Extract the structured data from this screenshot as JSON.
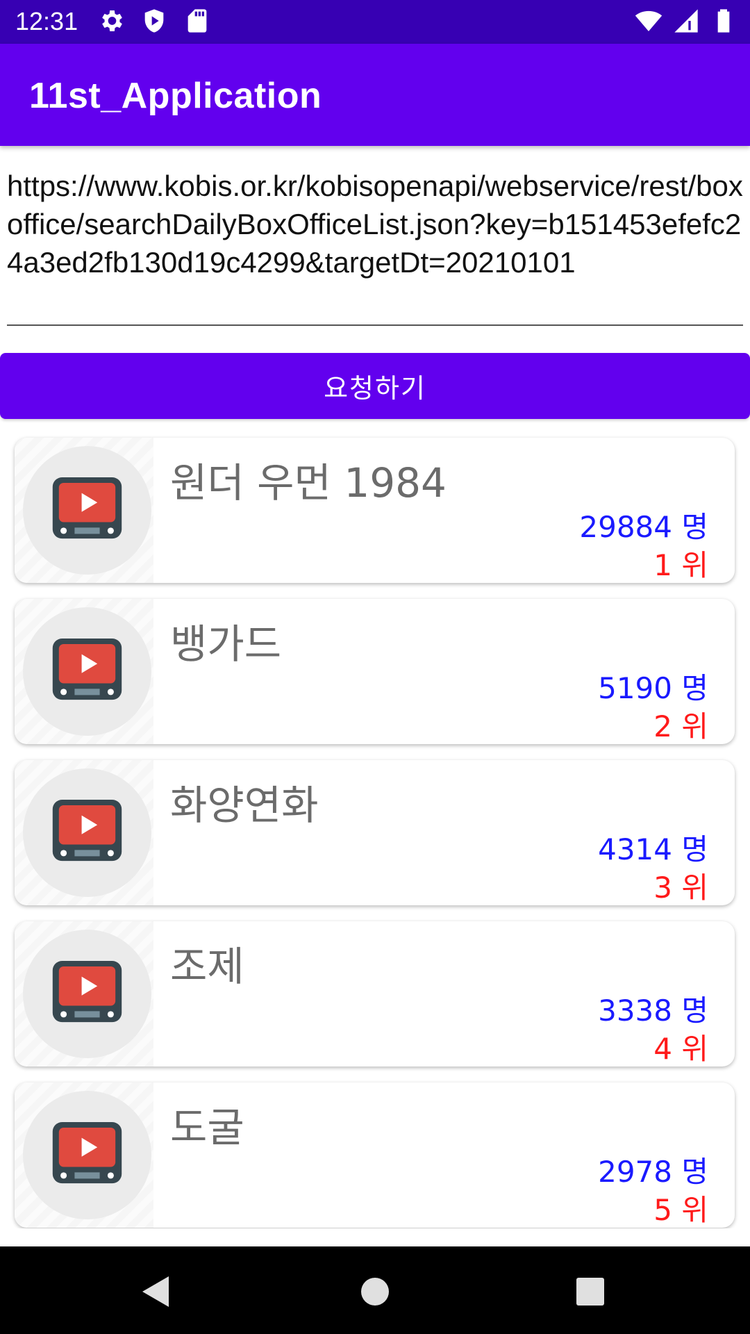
{
  "status_bar": {
    "time": "12:31",
    "left_icons": [
      "gear-icon",
      "shield-icon",
      "sd-card-icon"
    ],
    "right_icons": [
      "wifi-icon",
      "signal-icon",
      "battery-icon"
    ]
  },
  "app_bar": {
    "title": "11st_Application"
  },
  "url_input": {
    "value": "https://www.kobis.or.kr/kobisopenapi/webservice/rest/boxoffice/searchDailyBoxOfficeList.json?key=b151453efefc24a3ed2fb130d19c4299&targetDt=20210101"
  },
  "request_button": {
    "label": "요청하기"
  },
  "movies": [
    {
      "title": "원더 우먼 1984",
      "audience": "29884 명",
      "rank": "1 위",
      "icon": "tv-play-icon"
    },
    {
      "title": "뱅가드",
      "audience": "5190 명",
      "rank": "2 위",
      "icon": "tv-play-icon"
    },
    {
      "title": "화양연화",
      "audience": "4314 명",
      "rank": "3 위",
      "icon": "tv-play-icon"
    },
    {
      "title": "조제",
      "audience": "3338 명",
      "rank": "4 위",
      "icon": "tv-play-icon"
    },
    {
      "title": "도굴",
      "audience": "2978 명",
      "rank": "5 위",
      "icon": "tv-play-icon"
    }
  ],
  "nav_bar": {
    "buttons": [
      "back-icon",
      "home-icon",
      "recents-icon"
    ]
  },
  "colors": {
    "status_bar": "#3700B3",
    "primary": "#6200EE",
    "audience_text": "#1a1aff",
    "rank_text": "#ff1a1a"
  }
}
